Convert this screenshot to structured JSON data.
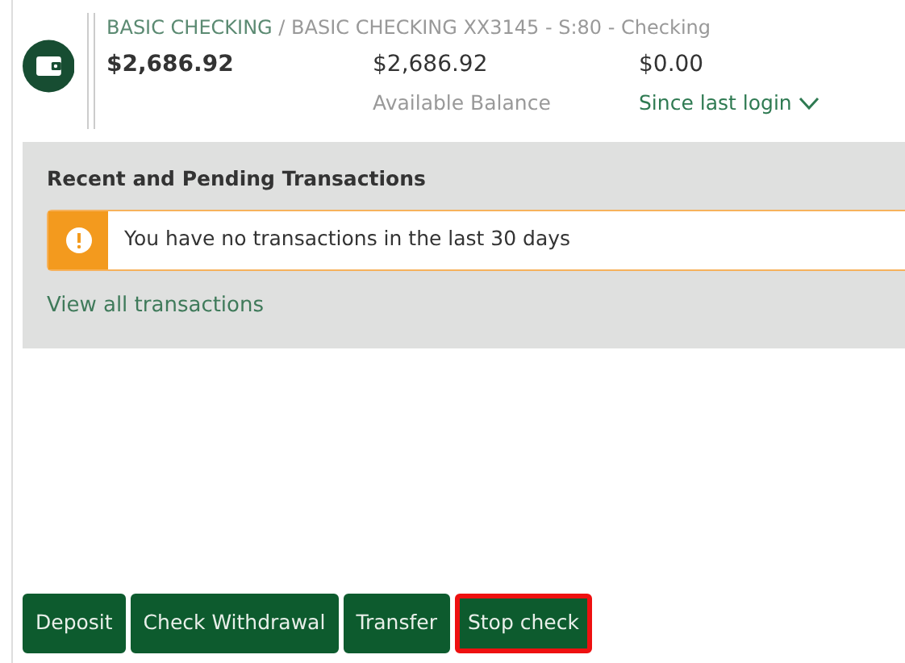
{
  "account": {
    "breadcrumb_link": "BASIC CHECKING",
    "separator": "/",
    "breadcrumb_current": "BASIC CHECKING XX3145 - S:80 - Checking",
    "balances": [
      {
        "amount": "$2,686.92",
        "kind": "primary"
      },
      {
        "amount": "$2,686.92",
        "label": "Available Balance",
        "kind": "caption"
      },
      {
        "amount": "$0.00",
        "label": "Since last login",
        "kind": "toggle",
        "expanded": false
      }
    ]
  },
  "transactions": {
    "title": "Recent and Pending Transactions",
    "alert": "You have no transactions in the last 30 days",
    "link": "View all transactions"
  },
  "buttons": [
    {
      "label": "Deposit",
      "highlighted": false
    },
    {
      "label": "Check Withdrawal",
      "highlighted": false
    },
    {
      "label": "Transfer",
      "highlighted": false
    },
    {
      "label": "Stop check",
      "highlighted": true
    }
  ]
}
